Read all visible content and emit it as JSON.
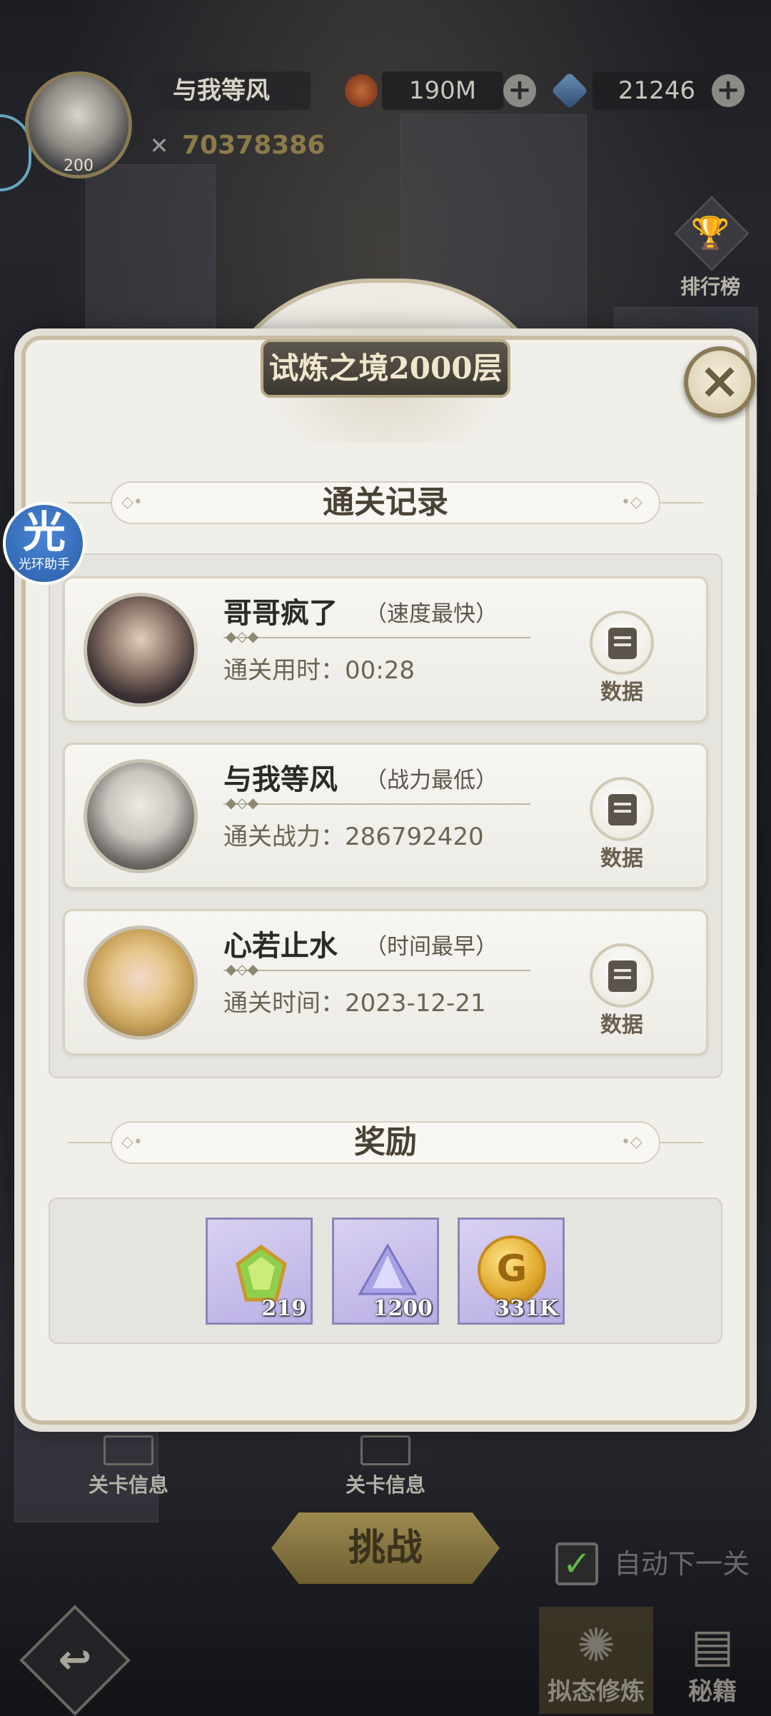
{
  "hud": {
    "player_name": "与我等风",
    "player_level": "200",
    "power": "70378386",
    "gold": "190M",
    "gems": "21246",
    "plus": "+",
    "ranking_label": "排行榜"
  },
  "helper": {
    "glyph": "光",
    "label": "光环助手"
  },
  "panel": {
    "title": "试炼之境2000层",
    "close": "×",
    "records_header": "通关记录",
    "rewards_header": "奖励",
    "data_button": "数据",
    "records": [
      {
        "name": "哥哥疯了",
        "tag": "（速度最快）",
        "stat": "通关用时：00:28"
      },
      {
        "name": "与我等风",
        "tag": "（战力最低）",
        "stat": "通关战力：286792420"
      },
      {
        "name": "心若止水",
        "tag": "（时间最早）",
        "stat": "通关时间：2023-12-21"
      }
    ],
    "rewards": [
      {
        "icon": "green-gem-icon",
        "qty": "219"
      },
      {
        "icon": "crystal-ore-icon",
        "qty": "1200"
      },
      {
        "icon": "gold-coin-icon",
        "qty": "331K"
      }
    ]
  },
  "background": {
    "stage_info_1": "关卡信息",
    "stage_info_2": "关卡信息",
    "challenge": "挑战",
    "auto_next": "自动下一关",
    "tab_cultivate": "拟态修炼",
    "tab_secret": "秘籍"
  },
  "colors": {
    "panel_bg": "#f1efea",
    "panel_border": "#c9bea1",
    "title_plate": "#4a463d",
    "text_dark": "#2c2a27",
    "text_muted": "#6e6454",
    "reward_bg": "#c9c0ec",
    "helper_blue": "#3a73c4"
  }
}
